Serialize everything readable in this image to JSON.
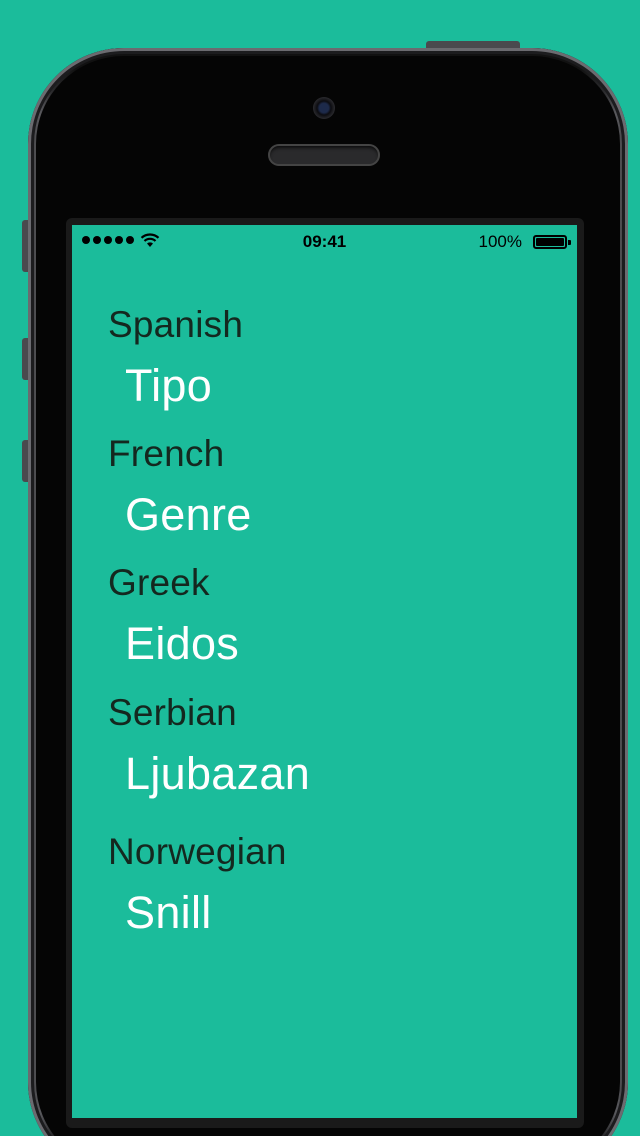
{
  "status_bar": {
    "time": "09:41",
    "battery_percent": "100%",
    "signal_bars": 5,
    "wifi_icon": "wifi-icon",
    "battery_icon": "battery-icon"
  },
  "colors": {
    "background": "#1bbc9b",
    "language_text": "#14281f",
    "word_text": "#ffffff"
  },
  "translations": [
    {
      "language": "Spanish",
      "word": "Tipo"
    },
    {
      "language": "French",
      "word": "Genre"
    },
    {
      "language": "Greek",
      "word": "Eidos"
    },
    {
      "language": "Serbian",
      "word": "Ljubazan"
    },
    {
      "language": "Norwegian",
      "word": "Snill"
    }
  ]
}
